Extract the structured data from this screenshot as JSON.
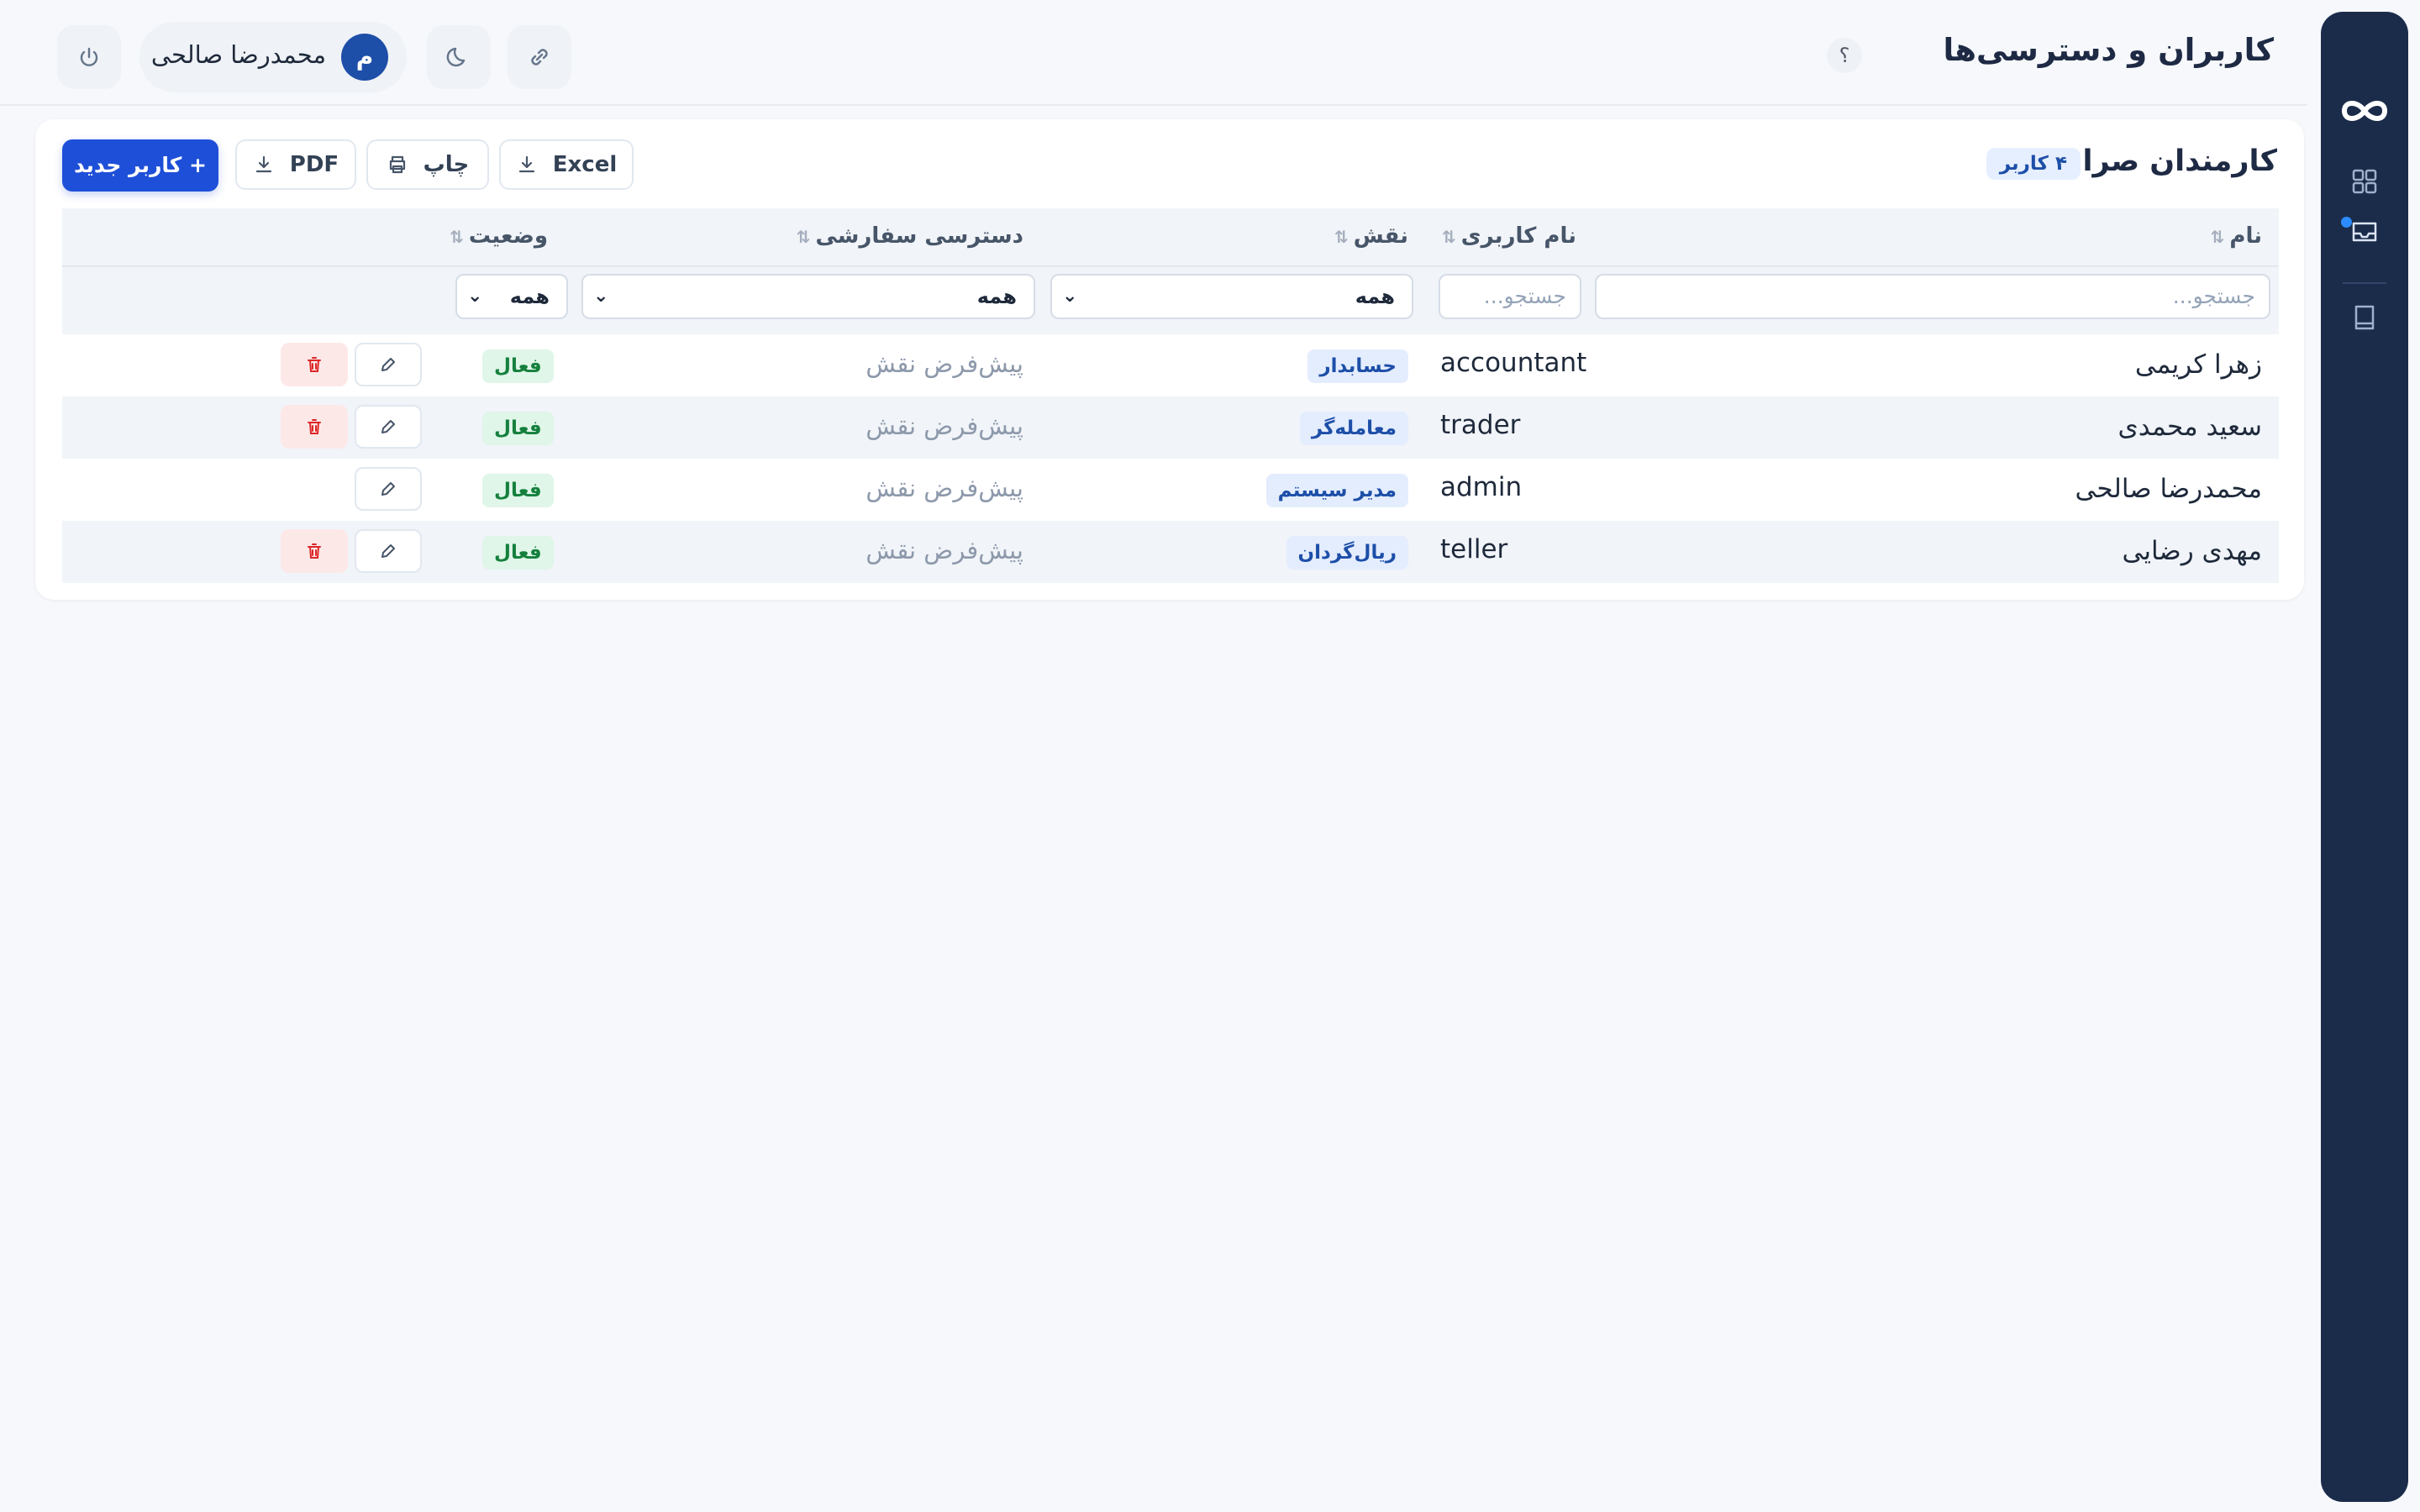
{
  "header": {
    "title": "کاربران و دسترسی‌ها",
    "help_label": "؟",
    "user_initial": "م",
    "user_name": "محمدرضا صالحی"
  },
  "card": {
    "title": "کارمندان صرافی",
    "count_badge": "۴ کاربر",
    "buttons": {
      "excel": "Excel",
      "print": "چاپ",
      "pdf": "PDF",
      "new_user": "+ کاربر جدید"
    }
  },
  "table": {
    "columns": {
      "name": "نام",
      "username": "نام کاربری",
      "role": "نقش",
      "access": "دسترسی سفارشی",
      "status": "وضعیت"
    },
    "filters": {
      "name_placeholder": "جستجو...",
      "username_placeholder": "جستجو...",
      "role_value": "همه",
      "access_value": "همه",
      "status_value": "همه"
    },
    "rows": [
      {
        "name": "زهرا کریمی",
        "username": "accountant",
        "role": "حسابدار",
        "access": "پیش‌فرض نقش",
        "status": "فعال",
        "deletable": true
      },
      {
        "name": "سعید محمدی",
        "username": "trader",
        "role": "معامله‌گر",
        "access": "پیش‌فرض نقش",
        "status": "فعال",
        "deletable": true
      },
      {
        "name": "محمدرضا صالحی",
        "username": "admin",
        "role": "مدیر سیستم",
        "access": "پیش‌فرض نقش",
        "status": "فعال",
        "deletable": false
      },
      {
        "name": "مهدی رضایی",
        "username": "teller",
        "role": "ریال‌گردان",
        "access": "پیش‌فرض نقش",
        "status": "فعال",
        "deletable": true
      }
    ]
  },
  "colors": {
    "primary": "#1e4fd8",
    "rail": "#1b2c4b",
    "status_active": "#15803d",
    "role_badge": "#1d4fa8",
    "delete": "#dc2626"
  },
  "icons": {
    "rail": [
      "infinity-logo-icon",
      "grid-icon",
      "inbox-icon",
      "book-icon"
    ],
    "header": [
      "help-icon",
      "link-icon",
      "moon-icon",
      "power-icon"
    ],
    "toolbar": [
      "download-icon",
      "printer-icon",
      "download-icon"
    ],
    "row_actions": [
      "pencil-icon",
      "trash-icon"
    ]
  }
}
